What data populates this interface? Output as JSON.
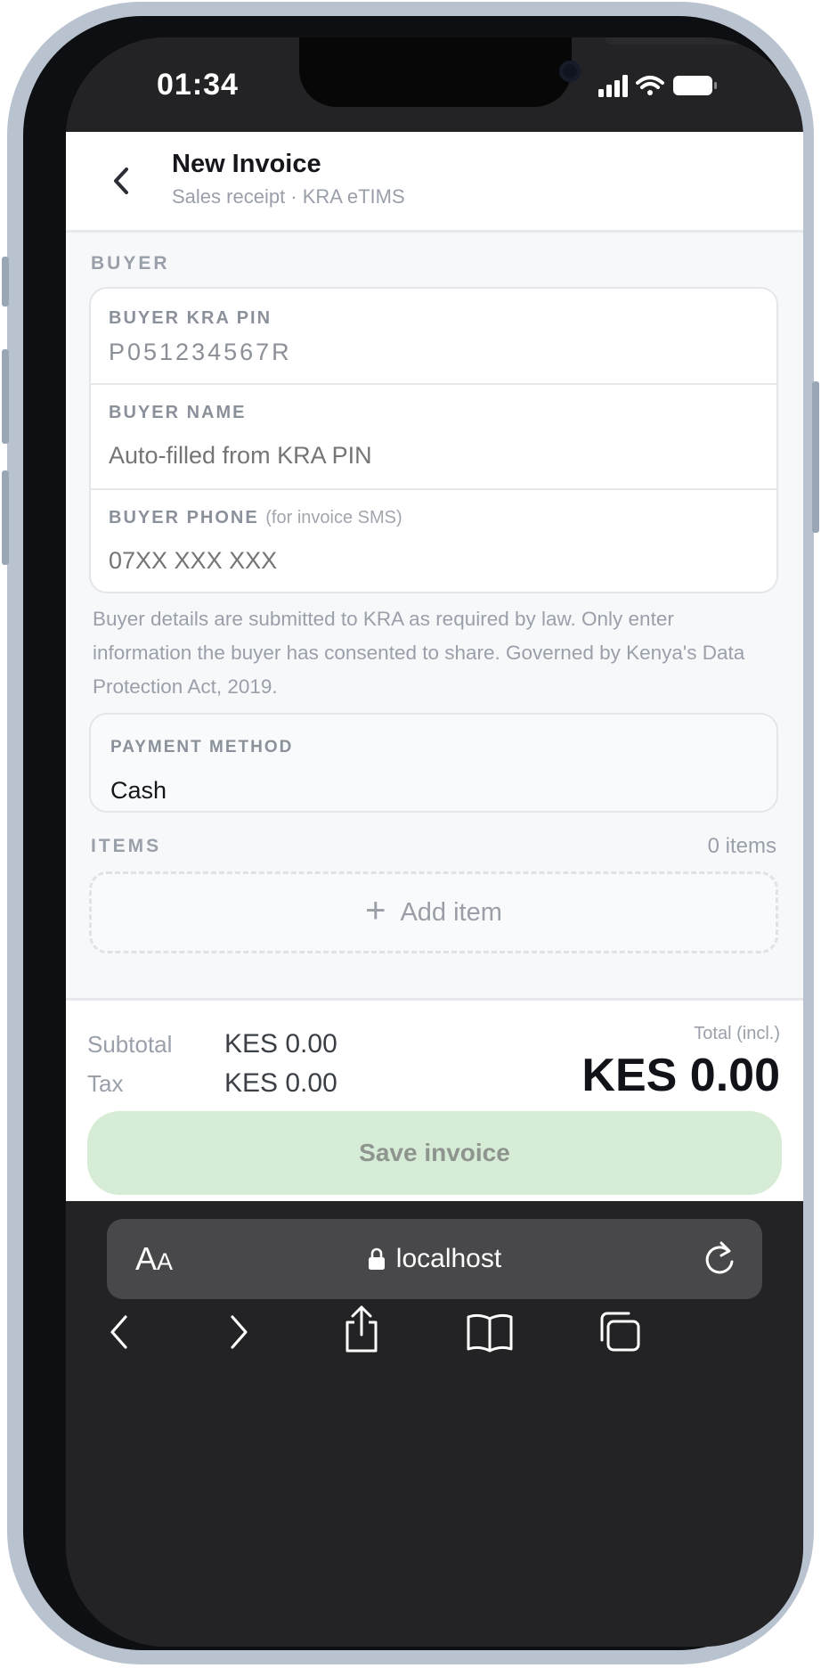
{
  "status_bar": {
    "time": "01:34"
  },
  "header": {
    "title": "New Invoice",
    "subtitle": "Sales receipt · KRA eTIMS"
  },
  "buyer": {
    "section_label": "BUYER",
    "kra_pin": {
      "label": "BUYER KRA PIN",
      "value": "P051234567R"
    },
    "name": {
      "label": "BUYER NAME",
      "placeholder": "Auto-filled from KRA PIN"
    },
    "phone": {
      "label": "BUYER PHONE",
      "hint": "(for invoice SMS)",
      "placeholder": "07XX XXX XXX"
    },
    "note": "Buyer details are submitted to KRA as required by law. Only enter information the buyer has consented to share. Governed by Kenya's Data Protection Act, 2019."
  },
  "payment": {
    "label": "PAYMENT METHOD",
    "value": "Cash"
  },
  "items": {
    "section_label": "ITEMS",
    "count": "0 items",
    "add_label": "Add item"
  },
  "totals": {
    "subtotal_label": "Subtotal",
    "subtotal_value": "KES 0.00",
    "tax_label": "Tax",
    "tax_value": "KES 0.00",
    "total_label": "Total (incl.)",
    "total_value": "KES 0.00"
  },
  "save_button": "Save invoice",
  "browser": {
    "text_size_big": "A",
    "text_size_small": "A",
    "url": "localhost"
  },
  "colors": {
    "save_button_bg": "#d6ecd6",
    "background": "#f7f8fa",
    "chrome": "#232325"
  }
}
